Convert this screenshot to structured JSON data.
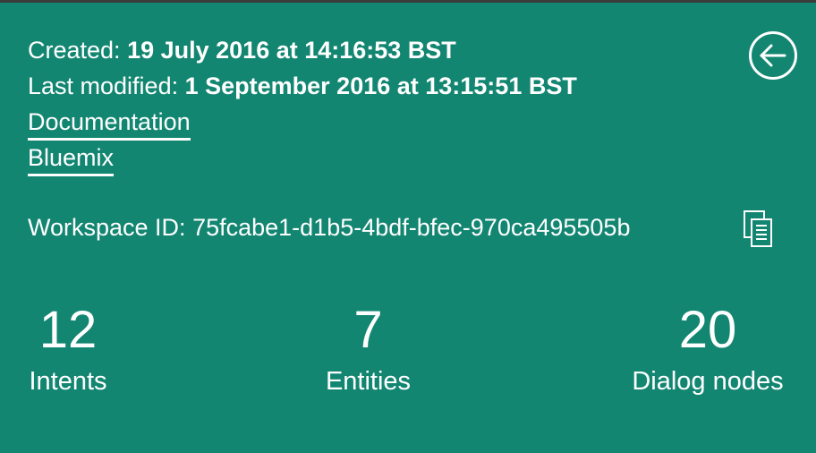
{
  "workspace": {
    "created_label": "Created:",
    "created_value": "19 July 2016 at 14:16:53 BST",
    "modified_label": "Last modified:",
    "modified_value": "1 September 2016 at 13:15:51 BST",
    "links": [
      "Documentation",
      "Bluemix"
    ],
    "id_label": "Workspace ID:",
    "id_value": "75fcabe1-d1b5-4bdf-bfec-970ca495505b"
  },
  "icons": {
    "back": "back-arrow-circle-icon",
    "copy": "copy-icon"
  },
  "stats": [
    {
      "value": "12",
      "label": "Intents"
    },
    {
      "value": "7",
      "label": "Entities"
    },
    {
      "value": "20",
      "label": "Dialog nodes"
    }
  ],
  "colors": {
    "background": "#138672",
    "text": "#ffffff",
    "topbar": "#3b3b3b"
  }
}
